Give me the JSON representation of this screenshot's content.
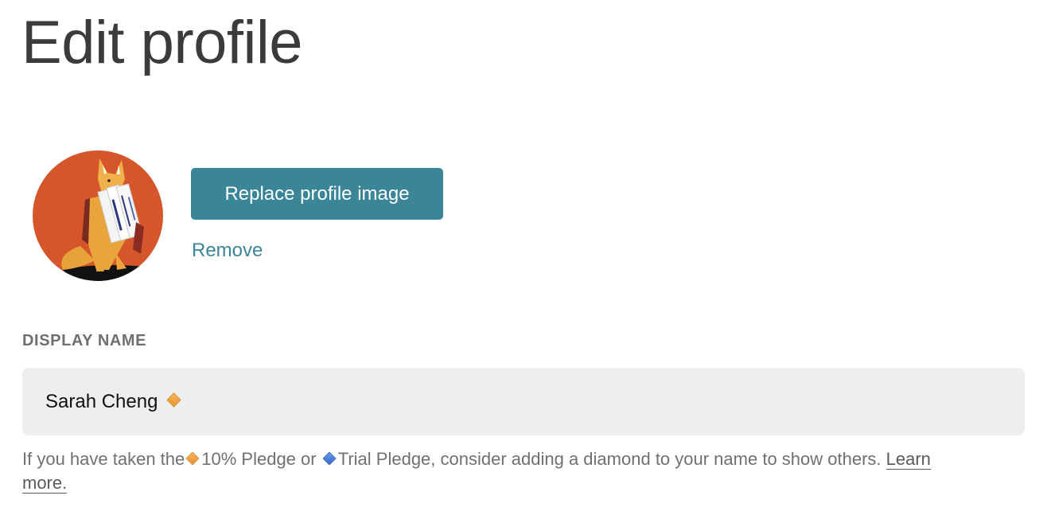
{
  "page": {
    "title": "Edit profile"
  },
  "profile_image": {
    "replace_label": "Replace profile image",
    "remove_label": "Remove",
    "icon": "fox-carrying-letters-avatar"
  },
  "display_name": {
    "label": "DISPLAY NAME",
    "value": "Sarah Cheng",
    "suffix_icon": "orange-diamond-icon"
  },
  "help": {
    "text_1": "If you have taken the",
    "pledge_1": "10% Pledge or",
    "pledge_2": "Trial Pledge, consider adding a diamond to your name to show others.",
    "learn_more": "Learn more."
  },
  "colors": {
    "accent": "#3b8598",
    "field_bg": "#eeeeee",
    "orange_diamond": "#e8922e",
    "blue_diamond": "#2f63c8",
    "avatar_bg": "#d4562a"
  }
}
